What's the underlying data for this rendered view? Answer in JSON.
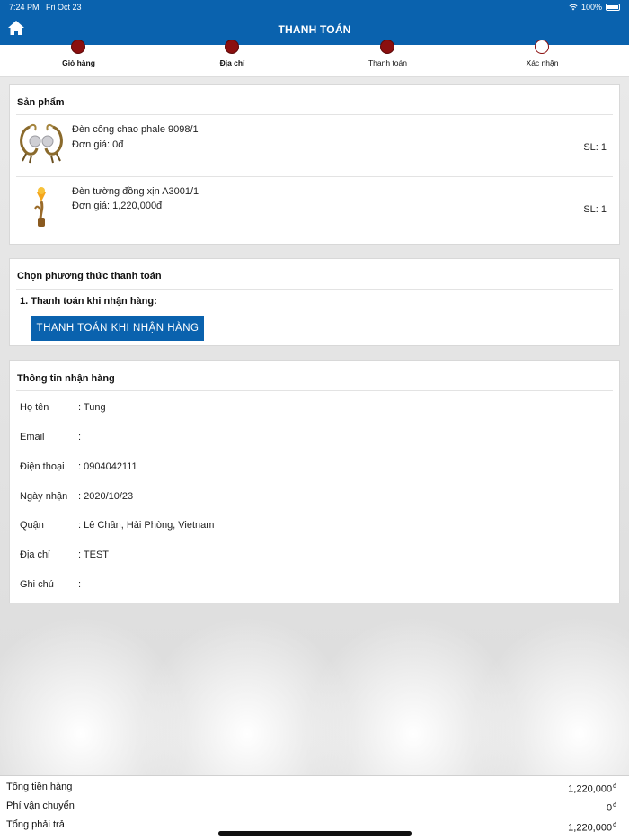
{
  "status_bar": {
    "time": "7:24 PM",
    "date": "Fri Oct 23",
    "battery": "100%"
  },
  "header": {
    "title": "THANH TOÁN"
  },
  "steps": [
    {
      "label": "Giỏ hàng",
      "done": true
    },
    {
      "label": "Địa chỉ",
      "done": true
    },
    {
      "label": "Thanh toán",
      "done": true
    },
    {
      "label": "Xác nhận",
      "done": false
    }
  ],
  "products": {
    "title": "Sản phẩm",
    "items": [
      {
        "name": "Đèn công chao phale 9098/1",
        "price": "Đơn giá: 0đ",
        "qty": "SL: 1",
        "image": "wall-lamp-pair-image"
      },
      {
        "name": "Đèn tường đồng xịn A3001/1",
        "price": "Đơn giá: 1,220,000đ",
        "qty": "SL: 1",
        "image": "wall-sconce-image"
      }
    ]
  },
  "payment": {
    "title": "Chọn phương thức thanh toán",
    "method_label": "1. Thanh toán khi nhận hàng:",
    "button_label": "THANH TOÁN KHI NHẬN HÀNG",
    "accent_color": "#0a62ae"
  },
  "shipping": {
    "title": "Thông tin nhận hàng",
    "fields": [
      {
        "label": "Họ tên",
        "value": ": Tung"
      },
      {
        "label": "Email",
        "value": ":"
      },
      {
        "label": "Điện thoại",
        "value": ": 0904042111"
      },
      {
        "label": "Ngày nhận",
        "value": ": 2020/10/23"
      },
      {
        "label": "Quận",
        "value": ": Lê Chân, Hải Phòng, Vietnam"
      },
      {
        "label": "Địa chỉ",
        "value": ": TEST"
      },
      {
        "label": "Ghi chú",
        "value": ":"
      }
    ]
  },
  "totals": {
    "subtotal_label": "Tổng tiền hàng",
    "subtotal_value": "1,220,000",
    "shipping_label": "Phí vận chuyển",
    "shipping_value": "0",
    "total_label": "Tổng phải trả",
    "total_value": "1,220,000",
    "currency": "đ"
  },
  "colors": {
    "header": "#0a62ae",
    "step_done": "#8b0f0f"
  }
}
